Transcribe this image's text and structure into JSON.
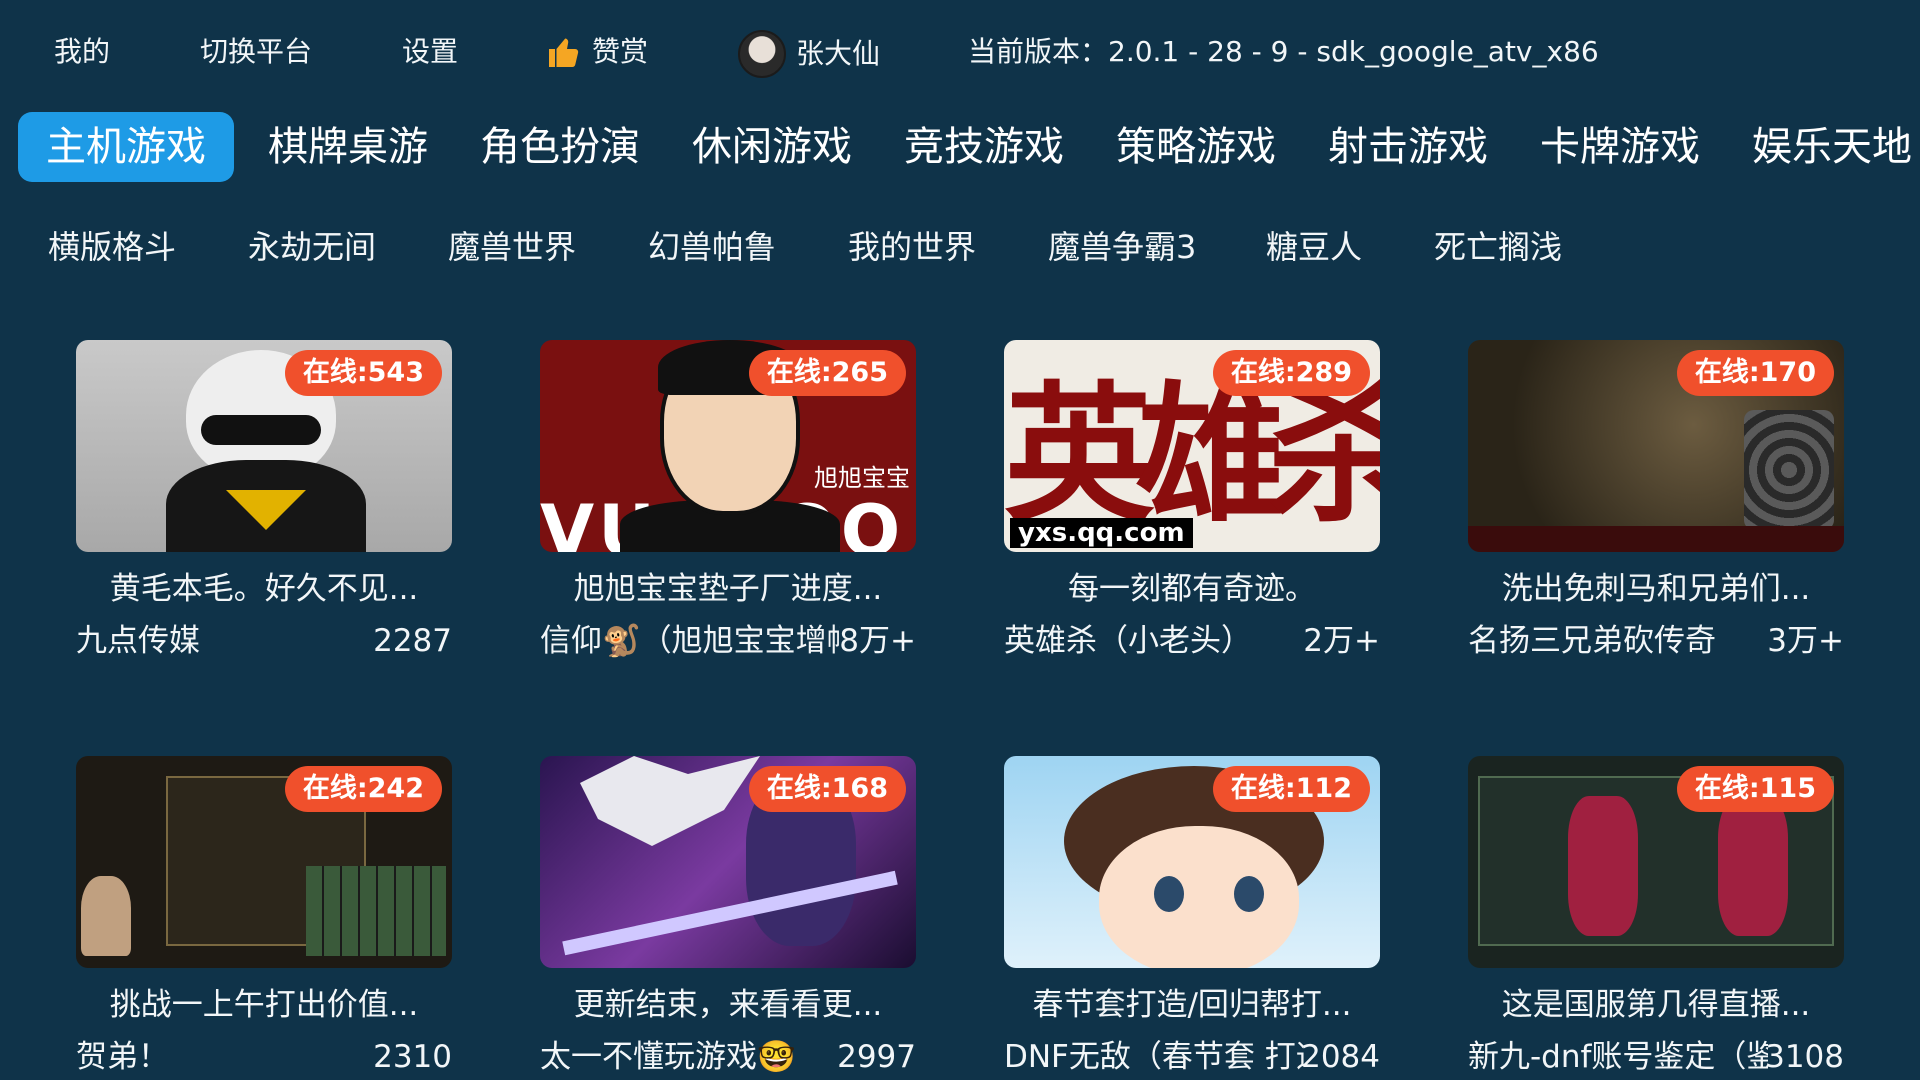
{
  "topbar": {
    "mine": "我的",
    "switch_platform": "切换平台",
    "settings": "设置",
    "donate": "赞赏",
    "username": "张大仙",
    "version": "当前版本：2.0.1 - 28 - 9 - sdk_google_atv_x86"
  },
  "categories": [
    "主机游戏",
    "棋牌桌游",
    "角色扮演",
    "休闲游戏",
    "竞技游戏",
    "策略游戏",
    "射击游戏",
    "卡牌游戏",
    "娱乐天地"
  ],
  "active_category": "主机游戏",
  "subcategories": [
    "横版格斗",
    "永劫无间",
    "魔兽世界",
    "幻兽帕鲁",
    "我的世界",
    "魔兽争霸3",
    "糖豆人",
    "死亡搁浅"
  ],
  "cards": [
    {
      "badge": "在线:543",
      "title": "黄毛本毛。好久不见...",
      "author": "九点传媒",
      "count": "2287"
    },
    {
      "badge": "在线:265",
      "title": "旭旭宝宝垫子厂进度...",
      "author": "信仰🐒（旭旭宝宝增幅助",
      "count": "8万+"
    },
    {
      "badge": "在线:289",
      "title": "每一刻都有奇迹。",
      "author": "英雄杀（小老头）",
      "count": "2万+"
    },
    {
      "badge": "在线:170",
      "title": "洗出免刺马和兄弟们...",
      "author": "名扬三兄弟砍传奇",
      "count": "3万+"
    },
    {
      "badge": "在线:242",
      "title": "挑战一上午打出价值...",
      "author": "贺弟！",
      "count": "2310"
    },
    {
      "badge": "在线:168",
      "title": "更新结束，来看看更...",
      "author": "太一不懂玩游戏🤓",
      "count": "2997"
    },
    {
      "badge": "在线:112",
      "title": "春节套打造/回归帮打...",
      "author": "DNF无敌（春节套 打造 增幅",
      "count": "2084"
    },
    {
      "badge": "在线:115",
      "title": "这是国服第几得直播...",
      "author": "新九-dnf账号鉴定（鉴定网...",
      "count": "3108"
    }
  ],
  "art_text": {
    "card2_big": "VUUBOO",
    "card2_cn": "旭旭宝宝",
    "card3_big": "英雄杀",
    "card3_url": "yxs.qq.com"
  }
}
